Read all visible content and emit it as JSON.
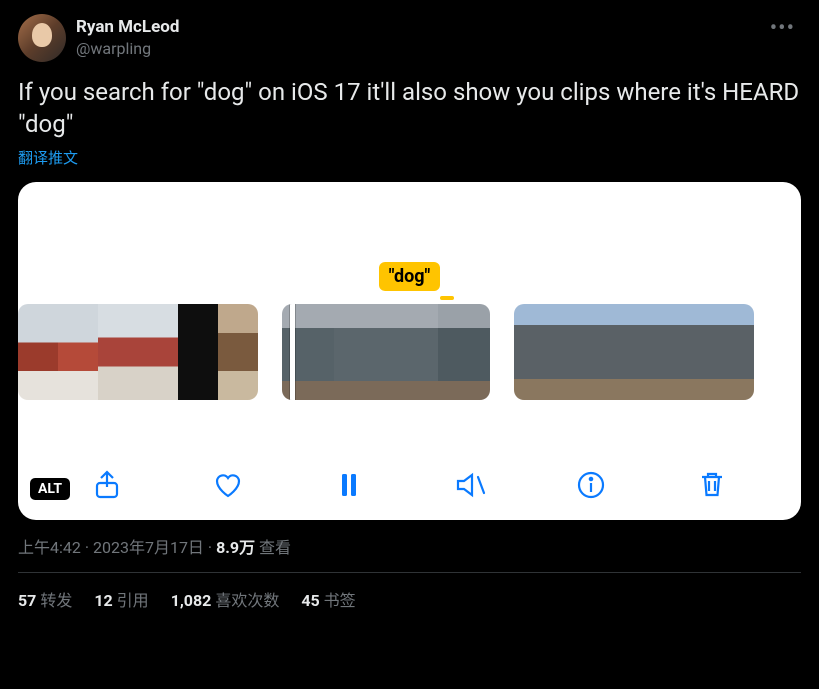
{
  "user": {
    "display_name": "Ryan McLeod",
    "handle": "@warpling"
  },
  "tweet": {
    "text": "If you search for \"dog\" on iOS 17 it'll also show you clips where it's HEARD \"dog\"",
    "translate_label": "翻译推文"
  },
  "media": {
    "tag": "\"dog\"",
    "alt_badge": "ALT"
  },
  "meta": {
    "time": "上午4:42",
    "date": "2023年7月17日",
    "views_count": "8.9万",
    "views_label": "查看"
  },
  "stats": {
    "retweets_count": "57",
    "retweets_label": "转发",
    "quotes_count": "12",
    "quotes_label": "引用",
    "likes_count": "1,082",
    "likes_label": "喜欢次数",
    "bookmarks_count": "45",
    "bookmarks_label": "书签"
  }
}
